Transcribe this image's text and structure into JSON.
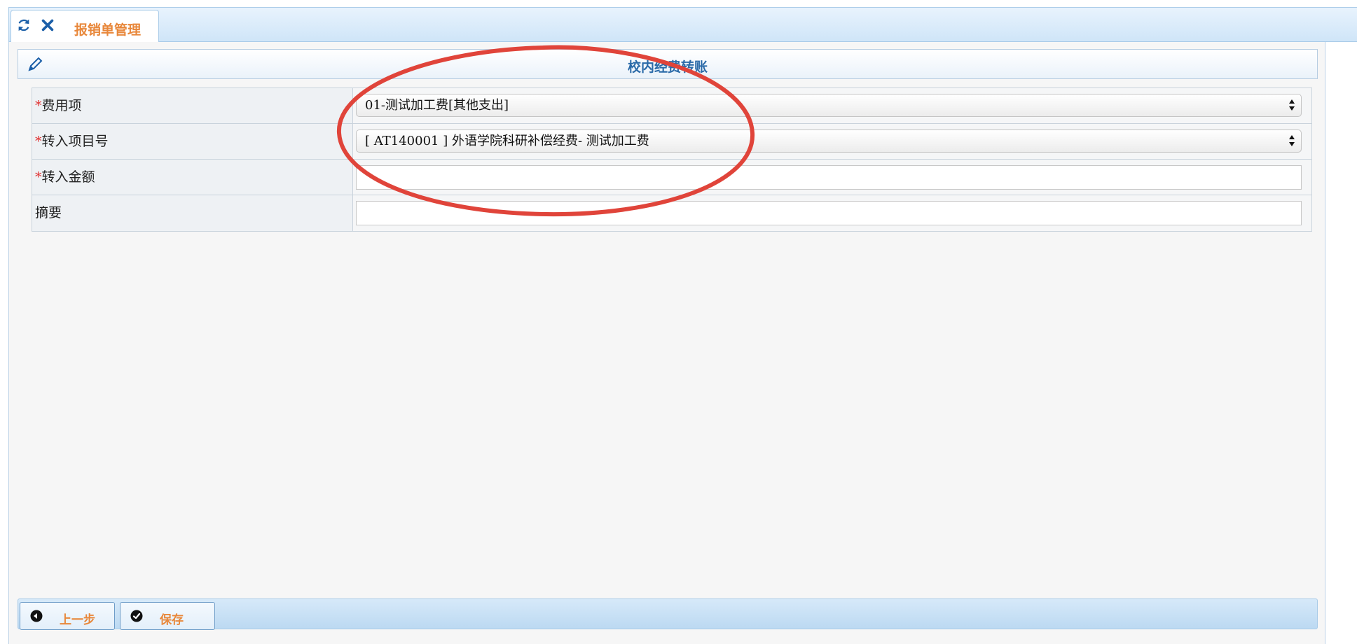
{
  "tab": {
    "label": "报销单管理",
    "refresh_icon": "refresh-icon",
    "close_icon": "close-icon"
  },
  "panel": {
    "title": "校内经费转账",
    "edit_icon": "pencil-icon"
  },
  "form": {
    "rows": [
      {
        "required_mark": "*",
        "label": "费用项",
        "type": "select",
        "value": "01-测试加工费[其他支出]"
      },
      {
        "required_mark": "*",
        "label": "转入项目号",
        "type": "select",
        "value": "[ AT140001 ] 外语学院科研补偿经费-  测试加工费"
      },
      {
        "required_mark": "*",
        "label": "转入金额",
        "type": "input",
        "value": ""
      },
      {
        "required_mark": "",
        "label": "摘要",
        "type": "input",
        "value": ""
      }
    ]
  },
  "toolbar": {
    "prev_label": "上一步",
    "save_label": "保存"
  },
  "colors": {
    "accent_orange": "#e8873a",
    "title_blue": "#2a6aa8",
    "required_red": "#e03030",
    "annotation_red": "#e0443a"
  }
}
